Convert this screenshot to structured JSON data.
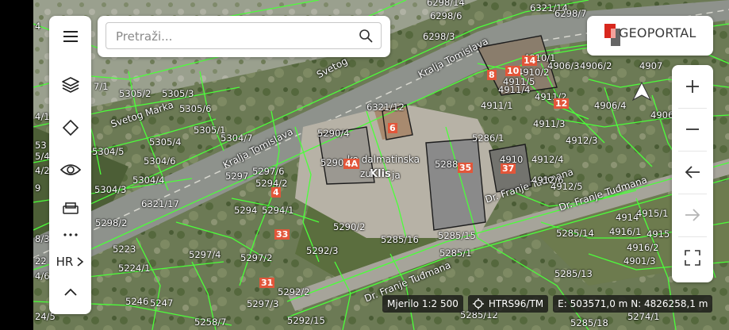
{
  "search": {
    "placeholder": "Pretraži..."
  },
  "logo": {
    "text": "GEOPORTAL"
  },
  "left_toolbar": {
    "items": [
      {
        "name": "menu",
        "icon": "hamburger-icon"
      },
      {
        "name": "layers",
        "icon": "layers-icon"
      },
      {
        "name": "draw",
        "icon": "diamond-icon"
      },
      {
        "name": "visibility",
        "icon": "eye-icon"
      },
      {
        "name": "print",
        "icon": "printer-icon"
      },
      {
        "name": "more",
        "icon": "ellipsis-icon"
      },
      {
        "name": "language",
        "icon": "chevron-right-icon"
      },
      {
        "name": "collapse",
        "icon": "chevron-up-icon"
      }
    ],
    "language_label": "HR"
  },
  "right_toolbar": {
    "items": [
      {
        "name": "zoom-in",
        "icon": "plus-icon"
      },
      {
        "name": "zoom-out",
        "icon": "minus-icon"
      },
      {
        "name": "back",
        "icon": "arrow-left-icon"
      },
      {
        "name": "forward",
        "icon": "arrow-right-icon"
      },
      {
        "name": "fullscreen",
        "icon": "fullscreen-icon"
      }
    ]
  },
  "status": {
    "scale": "Mjerilo 1:2 500",
    "crs": "HTRS96/TM",
    "coords": "E: 503571,0 m N: 4826258,1 m"
  },
  "colors": {
    "parcel_lines": "#4cff3a",
    "house_number_bg": "#e2563a",
    "toolbar_bg": "#ffffff",
    "status_bg": "#1a1a1a",
    "logo_red": "#d8281e"
  },
  "map": {
    "roads": [
      {
        "name": "Svetog Marka"
      },
      {
        "name": "Kralja Tomislava"
      },
      {
        "name": "Kralja Tomislava"
      },
      {
        "name": "Dr. Franje Tuđmana"
      },
      {
        "name": "Dr. Franje Tuđmana"
      },
      {
        "name": "Dr. Franje Tuđmana"
      },
      {
        "name": "Svetog"
      }
    ],
    "place_labels": [
      "Klis",
      "ko dalmatinska",
      "zu",
      "ja"
    ],
    "parcels": [
      "6298/14",
      "6298/6",
      "6298/3",
      "6321/14",
      "6298/7",
      "4907",
      "4906/2",
      "4906/3",
      "4910/1",
      "4910/2",
      "4911/5",
      "4911/4",
      "4911/2",
      "4911/1",
      "4911/3",
      "4906/4",
      "4906",
      "4912/3",
      "4912/4",
      "4910",
      "4912/6",
      "4912/5",
      "5305/2",
      "5305/3",
      "5305/6",
      "5305/1",
      "5305/4",
      "5304/5",
      "5304/6",
      "5304/7",
      "5304/4",
      "5304/3",
      "5290/4",
      "5290",
      "5297/6",
      "5294/2",
      "5297",
      "5294",
      "5294/1",
      "5290/2",
      "5292/3",
      "5285/16",
      "5285/15",
      "5285/1",
      "5286/1",
      "5288",
      "6321/12",
      "6321/17",
      "5298/2",
      "5223",
      "5224/1",
      "5297/4",
      "5297/2",
      "5292/2",
      "5297/3",
      "5246",
      "5247",
      "5258/7",
      "5292/15",
      "5285/13",
      "5285/14",
      "4916/1",
      "4915",
      "4916/2",
      "4901/3",
      "4914",
      "4915/1",
      "5285/12",
      "5285/18",
      "5274/1",
      "7/1",
      "4/15",
      "5/4",
      "4/2",
      "4/6",
      "8/3",
      "24/5",
      "22",
      "53",
      "9",
      "4"
    ],
    "house_numbers": [
      "14",
      "8",
      "10",
      "12",
      "6",
      "4A",
      "35",
      "37",
      "4",
      "33",
      "31"
    ]
  }
}
